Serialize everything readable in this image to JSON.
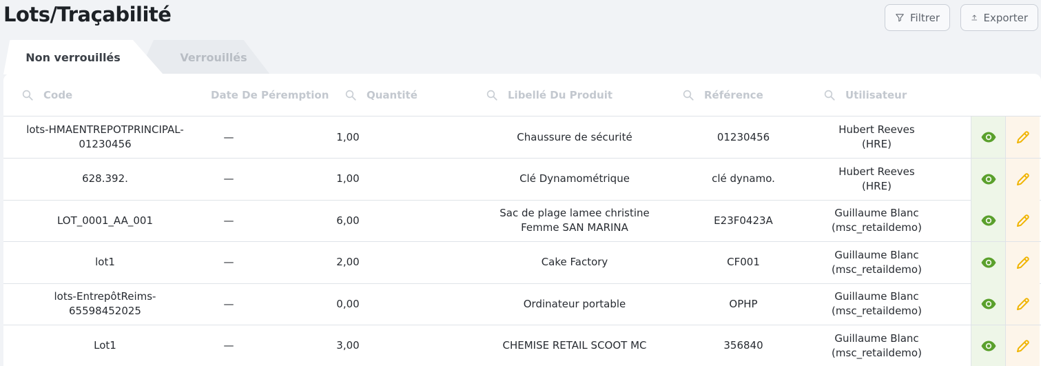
{
  "page": {
    "title": "Lots/Traçabilité"
  },
  "toolbar": {
    "filter_label": "Filtrer",
    "export_label": "Exporter"
  },
  "tabs": [
    {
      "label": "Non verrouillés",
      "active": true
    },
    {
      "label": "Verrouillés",
      "active": false
    }
  ],
  "columns": [
    "Code",
    "Date De Péremption",
    "Quantité",
    "Libellé Du Produit",
    "Référence",
    "Utilisateur"
  ],
  "rows": [
    {
      "code": "lots-HMAENTREPOTPRINCIPAL-01230456",
      "date": "—",
      "qty": "1,00",
      "product": "Chaussure de sécurité",
      "ref": "01230456",
      "user": "Hubert Reeves (HRE)"
    },
    {
      "code": "628.392.",
      "date": "—",
      "qty": "1,00",
      "product": "Clé Dynamométrique",
      "ref": "clé dynamo.",
      "user": "Hubert Reeves (HRE)"
    },
    {
      "code": "LOT_0001_AA_001",
      "date": "—",
      "qty": "6,00",
      "product": "Sac de plage lamee christine Femme SAN MARINA",
      "ref": "E23F0423A",
      "user": "Guillaume Blanc (msc_retaildemo)"
    },
    {
      "code": "lot1",
      "date": "—",
      "qty": "2,00",
      "product": "Cake Factory",
      "ref": "CF001",
      "user": "Guillaume Blanc (msc_retaildemo)"
    },
    {
      "code": "lots-EntrepôtReims-65598452025",
      "date": "—",
      "qty": "0,00",
      "product": "Ordinateur portable",
      "ref": "OPHP",
      "user": "Guillaume Blanc (msc_retaildemo)"
    },
    {
      "code": "Lot1",
      "date": "—",
      "qty": "3,00",
      "product": "CHEMISE RETAIL SCOOT MC",
      "ref": "356840",
      "user": "Guillaume Blanc (msc_retaildemo)"
    }
  ],
  "icons": {
    "filter": "funnel-icon",
    "export": "upload-icon",
    "search": "search-icon",
    "view": "eye-icon",
    "edit": "pencil-icon"
  },
  "colors": {
    "view_icon": "#5aa02c",
    "edit_icon": "#f0b400",
    "search_icon": "#c9ced4"
  }
}
